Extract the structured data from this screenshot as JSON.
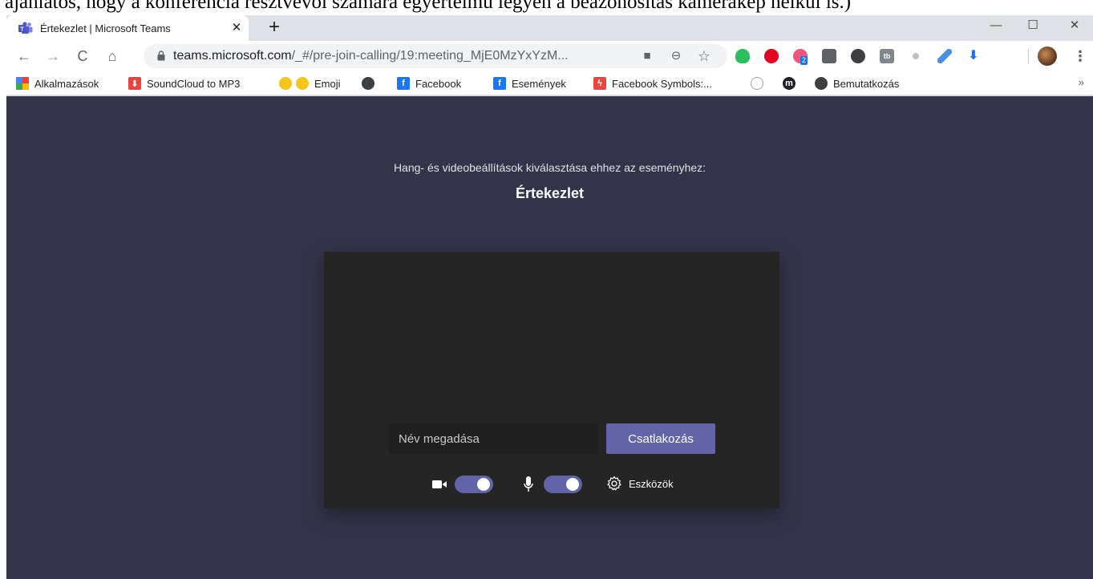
{
  "caption": {
    "text": "ajánlatos, hogy a konferencia résztvevői számára egyértelmű legyen a beazonosítás kamerakép nélkül is.)"
  },
  "browser": {
    "tab": {
      "title": "Értekezlet | Microsoft Teams",
      "close_glyph": "✕",
      "favicon": "teams-icon"
    },
    "new_tab_glyph": "+",
    "window_controls": {
      "minimize": "—",
      "maximize": "☐",
      "close": "✕"
    },
    "nav": {
      "back": "←",
      "forward": "→",
      "reload": "C",
      "home": "⌂"
    },
    "address": {
      "host": "teams.microsoft.com",
      "path": "/_#/pre-join-calling/19:meeting_MjE0MzYxYzM..."
    },
    "omnibox_icons": {
      "camera": "■",
      "zoom": "⊖",
      "star": "☆"
    },
    "extensions": [
      {
        "name": "evernote-icon",
        "color": "#2dbe60"
      },
      {
        "name": "pinterest-icon",
        "color": "#e60023"
      },
      {
        "name": "extension-badge-icon",
        "color": "#f0547a",
        "badge": "2"
      },
      {
        "name": "download-box-icon",
        "color": "#5f6368"
      },
      {
        "name": "download-circle-icon",
        "color": "#3c4043"
      },
      {
        "name": "tb-icon",
        "color": "#80868b",
        "label": "tb"
      },
      {
        "name": "sparkle-icon",
        "color": "#bdc1c6"
      },
      {
        "name": "feather-icon",
        "color": "#4a90e2"
      },
      {
        "name": "arrow-down-icon",
        "color": "#1a73e8"
      }
    ],
    "menu_glyph": "⋮",
    "bookmarks": [
      {
        "label": "Alkalmazások",
        "icon": "apps-grid-icon",
        "color": "#e8453c"
      },
      {
        "label": "SoundCloud to MP3",
        "icon": "download-red-icon",
        "color": "#e8453c"
      },
      {
        "label": "Emoji",
        "icon": "emoji-icon",
        "color": "#f5c518",
        "prefix": "😊"
      },
      {
        "label": "",
        "icon": "globe-icon",
        "color": "#3c4043"
      },
      {
        "label": "Facebook",
        "icon": "facebook-icon",
        "color": "#1877f2"
      },
      {
        "label": "Események",
        "icon": "facebook-icon",
        "color": "#1877f2"
      },
      {
        "label": "Facebook Symbols:...",
        "icon": "lightning-icon",
        "color": "#e8453c"
      },
      {
        "label": "",
        "icon": "seal-icon",
        "color": "#9aa0a6"
      },
      {
        "label": "",
        "icon": "m-circle-icon",
        "color": "#202124"
      },
      {
        "label": "Bemutatkozás",
        "icon": "globe-icon",
        "color": "#3c4043"
      }
    ],
    "bookmarks_more": "»"
  },
  "teams": {
    "prompt": "Hang- és videobeállítások kiválasztása ehhez az eseményhez:",
    "meeting_title": "Értekezlet",
    "name_placeholder": "Név megadása",
    "join_label": "Csatlakozás",
    "camera_on": true,
    "mic_on": true,
    "devices_label": "Eszközök",
    "accent": "#6264a7",
    "background": "#33344a"
  }
}
